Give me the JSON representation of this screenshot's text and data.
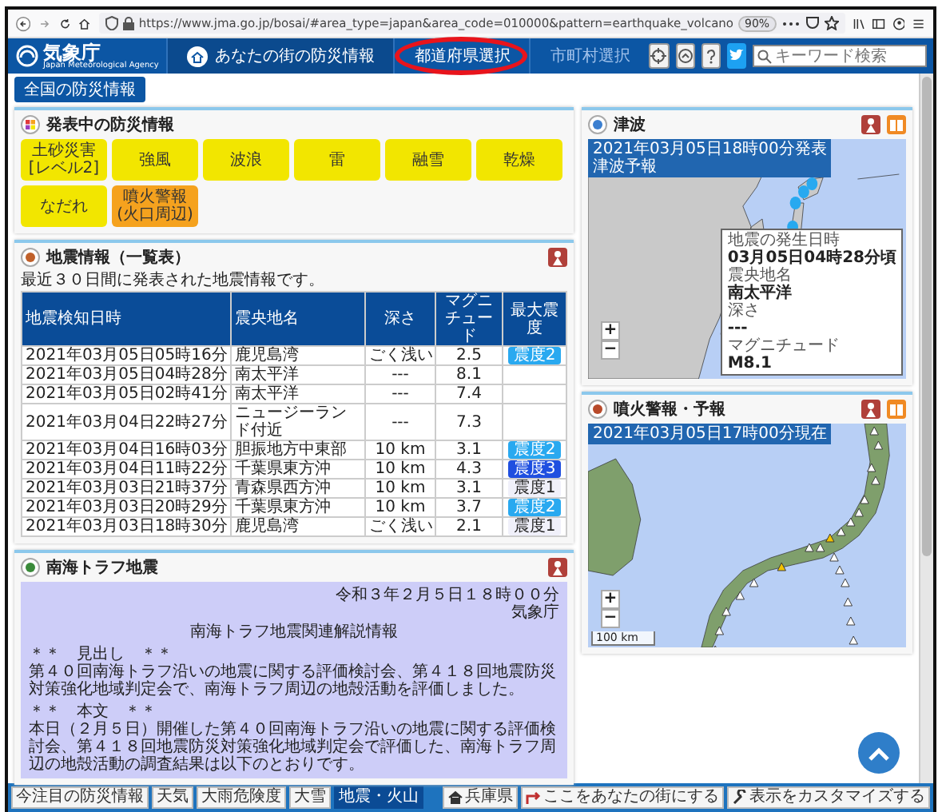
{
  "browser": {
    "url": "https://www.jma.go.jp/bosai/#area_type=japan&area_code=010000&pattern=earthquake_volcano",
    "zoom": "90%"
  },
  "header": {
    "logo": "気象庁",
    "logo_sub": "Japan Meteorological Agency",
    "nav": [
      {
        "label": "あなたの街の防災情報",
        "disabled": false,
        "highlighted": false
      },
      {
        "label": "都道府県選択",
        "disabled": false,
        "highlighted": true
      },
      {
        "label": "市町村選択",
        "disabled": true,
        "highlighted": false
      }
    ],
    "search": {
      "placeholder": "キーワード検索"
    }
  },
  "subtab": {
    "label": "全国の防災情報"
  },
  "warnings": {
    "title": "発表中の防災情報",
    "items": [
      {
        "label": "土砂災害",
        "sublabel": "[レベル2]",
        "color": "#f2e600"
      },
      {
        "label": "強風",
        "color": "#f2e600"
      },
      {
        "label": "波浪",
        "color": "#f2e600"
      },
      {
        "label": "雷",
        "color": "#f2e600"
      },
      {
        "label": "融雪",
        "color": "#f2e600"
      },
      {
        "label": "乾燥",
        "color": "#f2e600"
      },
      {
        "label": "なだれ",
        "color": "#f2e600"
      },
      {
        "label": "噴火警報",
        "sublabel": "(火口周辺)",
        "color": "#f5a21e"
      }
    ]
  },
  "earthquakes": {
    "title": "地震情報（一覧表）",
    "caption": "最近３０日間に発表された地震情報です。",
    "columns": [
      "地震検知日時",
      "震央地名",
      "深さ",
      "マグニチュード",
      "最大震度"
    ],
    "rows": [
      {
        "cells": [
          "2021年03月05日05時16分",
          "鹿児島湾",
          "ごく浅い",
          "2.5"
        ],
        "intensity": {
          "label": "震度2",
          "color": "#29a9f0"
        }
      },
      {
        "cells": [
          "2021年03月05日04時28分",
          "南太平洋",
          "---",
          "8.1"
        ]
      },
      {
        "cells": [
          "2021年03月05日02時41分",
          "南太平洋",
          "---",
          "7.4"
        ]
      },
      {
        "cells": [
          "2021年03月04日22時27分",
          "ニュージーランド付近",
          "---",
          "7.3"
        ]
      },
      {
        "cells": [
          "2021年03月04日16時03分",
          "胆振地方中東部",
          "10 km",
          "3.1"
        ],
        "intensity": {
          "label": "震度2",
          "color": "#29a9f0"
        }
      },
      {
        "cells": [
          "2021年03月04日11時22分",
          "千葉県東方沖",
          "10 km",
          "4.3"
        ],
        "intensity": {
          "label": "震度3",
          "color": "#1f4fe0"
        }
      },
      {
        "cells": [
          "2021年03月03日21時37分",
          "青森県西方沖",
          "10 km",
          "3.1"
        ],
        "intensity": {
          "label": "震度1",
          "color": "#f0f0fa"
        }
      },
      {
        "cells": [
          "2021年03月03日20時29分",
          "千葉県東方沖",
          "10 km",
          "3.7"
        ],
        "intensity": {
          "label": "震度2",
          "color": "#29a9f0"
        }
      },
      {
        "cells": [
          "2021年03月03日18時30分",
          "鹿児島湾",
          "ごく浅い",
          "2.1"
        ],
        "intensity": {
          "label": "震度1",
          "color": "#f0f0fa"
        }
      }
    ]
  },
  "nankai": {
    "title": "南海トラフ地震",
    "paragraphs": [
      {
        "kind": "right",
        "text": "令和３年２月５日１８時００分"
      },
      {
        "kind": "right",
        "text": "気象庁"
      },
      {
        "kind": "center",
        "text": "南海トラフ地震関連解説情報"
      },
      {
        "kind": "heading",
        "text": "＊＊　見出し　＊＊"
      },
      {
        "kind": "body",
        "text": "第４０回南海トラフ沿いの地震に関する評価検討会、第４１８回地震防災対策強化地域判定会で、南海トラフ周辺の地殻活動を評価しました。"
      },
      {
        "kind": "heading",
        "text": "＊＊　本文　＊＊"
      },
      {
        "kind": "body",
        "text": "本日（２月５日）開催した第４０回南海トラフ沿いの地震に関する評価検討会、第４１８回地震防災対策強化地域判定会で評価した、南海トラフ周辺の地殻活動の調査結果は以下のとおりです。"
      }
    ]
  },
  "tsunami": {
    "title": "津波",
    "stamp": "2021年03月05日18時00分発表",
    "stamp_sub": "津波予報",
    "zoom": [
      "+",
      "−"
    ],
    "info": [
      {
        "label": "地震の発生日時",
        "value": "03月05日04時28分頃"
      },
      {
        "label": "震央地名",
        "value": "南太平洋"
      },
      {
        "label": "深さ",
        "value": "---"
      },
      {
        "label": "マグニチュード",
        "value": "M8.1"
      }
    ]
  },
  "volcano": {
    "title": "噴火警報・予報",
    "stamp": "2021年03月05日17時00分現在",
    "zoom": [
      "+",
      "−"
    ],
    "scale": "100 km"
  },
  "footer": {
    "tabs": [
      {
        "label": "今注目の防災情報",
        "selected": false
      },
      {
        "label": "天気",
        "selected": false
      },
      {
        "label": "大雨危険度",
        "selected": false
      },
      {
        "label": "大雪",
        "selected": false
      },
      {
        "label": "地震・火山",
        "selected": true
      }
    ],
    "actions": [
      {
        "label": "兵庫県"
      },
      {
        "label": "ここをあなたの街にする"
      },
      {
        "label": "表示をカスタマイズする"
      }
    ]
  }
}
